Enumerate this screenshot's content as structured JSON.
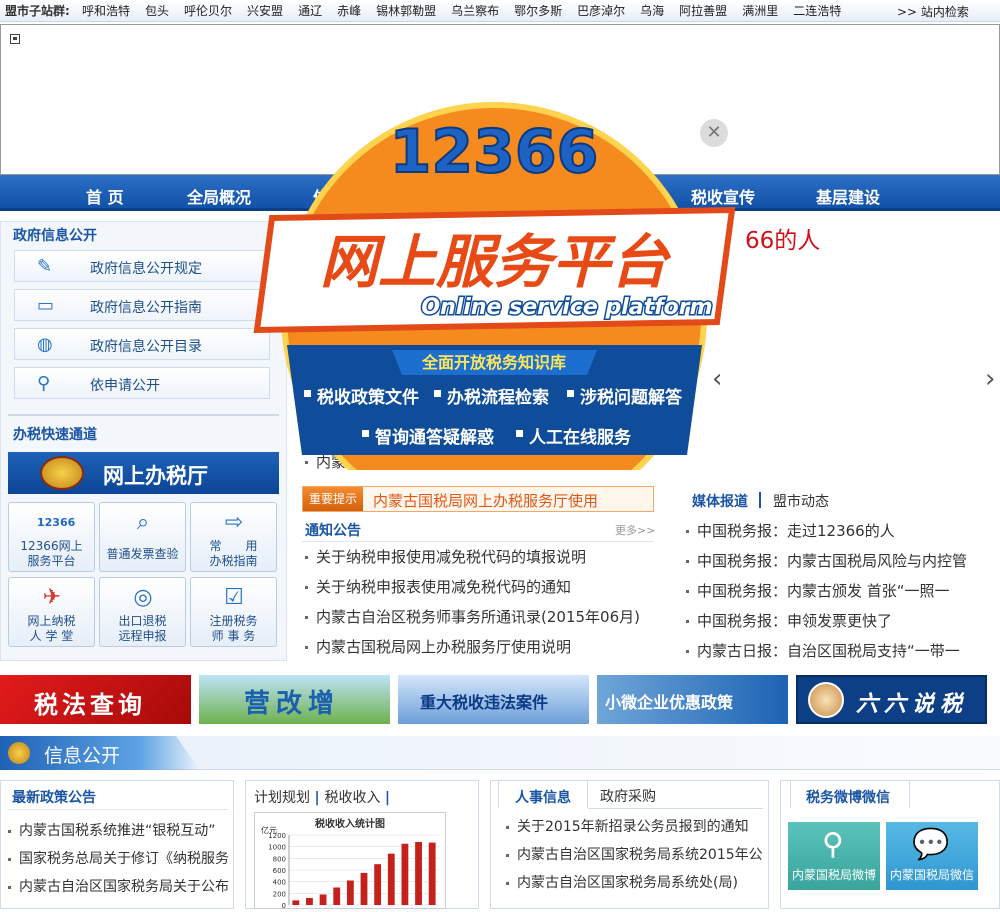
{
  "topbar": {
    "label": "盟市子站群:",
    "cities": [
      "呼和浩特",
      "包头",
      "呼伦贝尔",
      "兴安盟",
      "通辽",
      "赤峰",
      "锡林郭勒盟",
      "乌兰察布",
      "鄂尔多斯",
      "巴彦淖尔",
      "乌海",
      "阿拉善盟",
      "满洲里",
      "二连浩特"
    ],
    "search": ">> 站内检索"
  },
  "nav": [
    "首 页",
    "全局概况",
    "信息公开",
    "",
    "",
    "税收宣传",
    "基层建设"
  ],
  "left": {
    "gov_title": "政府信息公开",
    "gov_items": [
      "政府信息公开规定",
      "政府信息公开指南",
      "政府信息公开目录",
      "依申请公开"
    ],
    "quick_title": "办税快速通道",
    "online_hall": "网上办税厅",
    "tiles": [
      [
        "12366网上",
        "服务平台"
      ],
      [
        "普通发票查验",
        ""
      ],
      [
        "常　　用",
        "办税指南"
      ],
      [
        "网上纳税",
        "人 学 堂"
      ],
      [
        "出口退税",
        "远程申报"
      ],
      [
        "注册税务",
        "师 事 务"
      ]
    ]
  },
  "headline_peek": "66的人",
  "peek_item": "内蒙古国税局网上办税服务厅使用说明",
  "important": {
    "tag": "重要提示",
    "text": "内蒙古国税局网上办税服务厅使用"
  },
  "notices": {
    "title": "通知公告",
    "more": "更多>>",
    "items": [
      "关于纳税申报使用减免税代码的填报说明",
      "关于纳税申报表使用减免税代码的通知",
      "内蒙古自治区税务师事务所通讯录(2015年06月)",
      "内蒙古国税局网上办税服务厅使用说明"
    ]
  },
  "media": {
    "title": "媒体报道",
    "sub": "盟市动态",
    "items": [
      "中国税务报：走过12366的人",
      "中国税务报：内蒙古国税局风险与内控管",
      "中国税务报：内蒙古颁发 首张“一照一",
      "中国税务报：申领发票更快了",
      "内蒙古日报：自治区国税局支持“一带一"
    ]
  },
  "ads": [
    "税法查询",
    "营改增",
    "重大税收违法案件",
    "小微企业优惠政策",
    "六六说税"
  ],
  "info": {
    "title": "信息公开",
    "policy_title": "最新政策公告",
    "policy_items": [
      "内蒙古国税系统推进“银税互动”",
      "国家税务总局关于修订《纳税服务",
      "内蒙古自治区国家税务局关于公布"
    ],
    "plan_tabs": [
      "计划规划",
      "税收收入"
    ],
    "hr_tabs": [
      "人事信息",
      "政府采购"
    ],
    "hr_items": [
      "关于2015年新招录公务员报到的通知",
      "内蒙古自治区国家税务局系统2015年公",
      "内蒙古自治区国家税务局系统处(局)"
    ],
    "weibo_title": "税务微博微信",
    "weibo": "内蒙国税局微博",
    "weixin": "内蒙国税局微信"
  },
  "chart_data": {
    "type": "bar",
    "title": "税收收入统计图",
    "ylabel": "亿元",
    "yticks": [
      0,
      200,
      400,
      600,
      800,
      1000,
      1200
    ],
    "ylim": [
      0,
      1200
    ],
    "values": [
      80,
      120,
      180,
      300,
      420,
      550,
      700,
      880,
      1050,
      1080,
      1070
    ]
  },
  "popup": {
    "number": "12366",
    "title": "网上服务平台",
    "subtitle": "Online service platform",
    "banner": "全面开放税务知识库",
    "row1": [
      "税收政策文件",
      "办税流程检索",
      "涉税问题解答"
    ],
    "row2": [
      "智询通答疑解惑",
      "人工在线服务"
    ]
  },
  "colors": {
    "nav": "#1a5cb3",
    "accent": "#1b56a5",
    "popup_orange": "#f58a1f",
    "popup_blue": "#0f4c9a"
  }
}
